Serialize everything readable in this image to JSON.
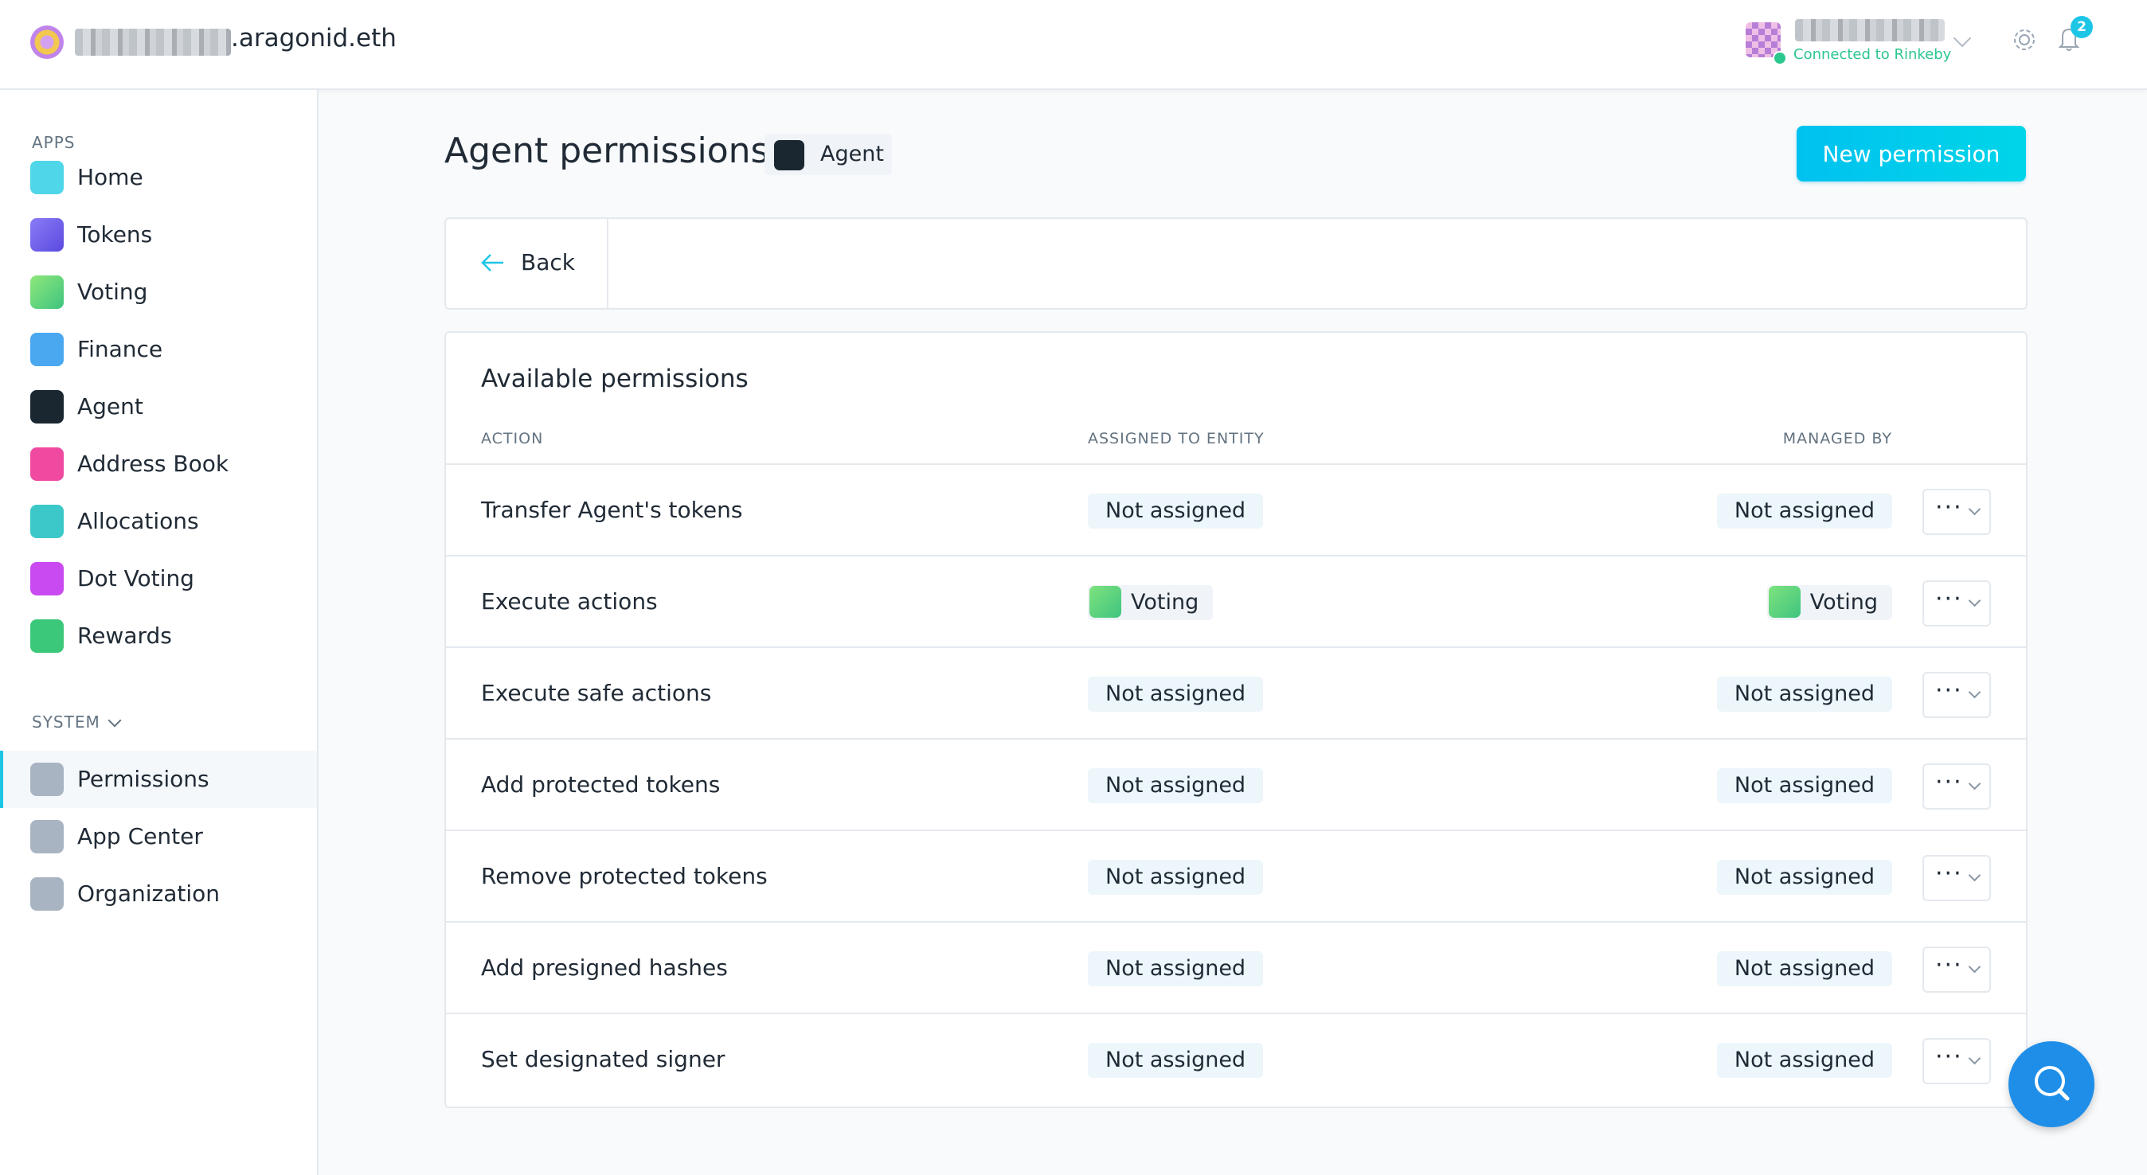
{
  "header": {
    "org_name": ".aragonid.eth",
    "connection_status": "Connected to Rinkeby",
    "notification_count": "2"
  },
  "sidebar": {
    "apps_label": "APPS",
    "system_label": "SYSTEM",
    "apps": [
      {
        "label": "Home",
        "icon": "home-icon",
        "color": "#4fd6e8"
      },
      {
        "label": "Tokens",
        "icon": "tokens-icon",
        "color": "#7a6cf2"
      },
      {
        "label": "Voting",
        "icon": "voting-icon",
        "color": "#5dd47a"
      },
      {
        "label": "Finance",
        "icon": "finance-icon",
        "color": "#4aa8f0"
      },
      {
        "label": "Agent",
        "icon": "agent-icon",
        "color": "#1b2730"
      },
      {
        "label": "Address Book",
        "icon": "address-book-icon",
        "color": "#f04aa0"
      },
      {
        "label": "Allocations",
        "icon": "allocations-icon",
        "color": "#3cc8c8"
      },
      {
        "label": "Dot Voting",
        "icon": "dot-voting-icon",
        "color": "#c94af0"
      },
      {
        "label": "Rewards",
        "icon": "rewards-icon",
        "color": "#3cc87a"
      }
    ],
    "system": [
      {
        "label": "Permissions",
        "icon": "permissions-icon",
        "active": true
      },
      {
        "label": "App Center",
        "icon": "app-center-icon"
      },
      {
        "label": "Organization",
        "icon": "organization-icon"
      }
    ]
  },
  "main": {
    "title": "Agent permissions",
    "app_badge": "Agent",
    "new_permission_label": "New permission",
    "back_label": "Back",
    "panel_title": "Available permissions",
    "columns": [
      "ACTION",
      "ASSIGNED TO ENTITY",
      "MANAGED BY"
    ],
    "rows": [
      {
        "action": "Transfer Agent's tokens",
        "entity": "Not assigned",
        "manager": "Not assigned"
      },
      {
        "action": "Execute actions",
        "entity": "Voting",
        "manager": "Voting"
      },
      {
        "action": "Execute safe actions",
        "entity": "Not assigned",
        "manager": "Not assigned"
      },
      {
        "action": "Add protected tokens",
        "entity": "Not assigned",
        "manager": "Not assigned"
      },
      {
        "action": "Remove protected tokens",
        "entity": "Not assigned",
        "manager": "Not assigned"
      },
      {
        "action": "Add presigned hashes",
        "entity": "Not assigned",
        "manager": "Not assigned"
      },
      {
        "action": "Set designated signer",
        "entity": "Not assigned",
        "manager": "Not assigned"
      }
    ],
    "more_label": "···"
  },
  "colors": {
    "accent": "#1ec6e6",
    "button": "#00c8ee",
    "fab": "#1e8ee8",
    "connected": "#2cc68f"
  }
}
